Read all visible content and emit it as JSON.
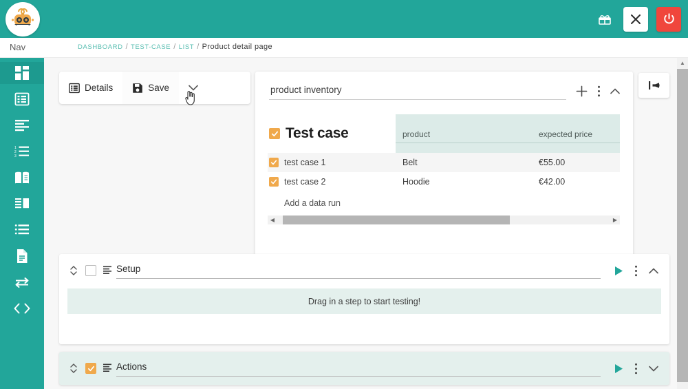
{
  "app": {
    "logo_alt": "robot-avatar-logo",
    "theme_color": "#22a69a",
    "accent_orange": "#f0a94c",
    "danger_color": "#f0463c",
    "panel_tint": "#e4f0ed",
    "table_header_tint": "#dcebe8"
  },
  "topbar": {
    "gift_icon": "gift-icon",
    "close_label": "✕",
    "power_icon": "power-icon"
  },
  "sidebar": {
    "nav_label": "Nav",
    "items": [
      {
        "name": "dashboard",
        "icon": "grid-icon",
        "active": true
      },
      {
        "name": "test-case-list",
        "icon": "list-alt-icon",
        "active": false
      },
      {
        "name": "align-left",
        "icon": "align-left-icon",
        "active": false
      },
      {
        "name": "ordered-list",
        "icon": "list-ol-icon",
        "active": false
      },
      {
        "name": "book",
        "icon": "book-icon",
        "active": false
      },
      {
        "name": "columns",
        "icon": "columns-icon",
        "active": false
      },
      {
        "name": "list",
        "icon": "list-icon",
        "active": false
      },
      {
        "name": "file",
        "icon": "file-icon",
        "active": false
      },
      {
        "name": "exchange",
        "icon": "exchange-icon",
        "active": false
      },
      {
        "name": "code",
        "icon": "code-icon",
        "active": false
      }
    ]
  },
  "breadcrumb": {
    "items": [
      "DASHBOARD",
      "TEST-CASE",
      "LIST"
    ],
    "separator": "/",
    "current": "Product detail page"
  },
  "toolbar": {
    "details_label": "Details",
    "details_icon": "list-alt-icon",
    "save_label": "Save",
    "save_icon": "floppy-disk-icon",
    "chevron_icon": "chevron-down-icon",
    "cursor": "hand-pointer-cursor"
  },
  "collapse_button": {
    "icon": "collapse-left-icon"
  },
  "inventory_panel": {
    "title_value": "product inventory",
    "title_placeholder": "product inventory",
    "add_icon": "plus-icon",
    "menu_icon": "dots-vertical-icon",
    "collapse_icon": "chevron-up-icon",
    "table": {
      "title": "Test case",
      "title_checked": true,
      "columns": [
        "product",
        "expected price"
      ],
      "rows": [
        {
          "label": "test case 1",
          "checked": true,
          "product": "Belt",
          "expected_price": "€55.00"
        },
        {
          "label": "test case 2",
          "checked": true,
          "product": "Hoodie",
          "expected_price": "€42.00"
        }
      ],
      "add_row_label": "Add a data run"
    },
    "hscroll": {
      "left_arrow": "◀",
      "right_arrow": "▶"
    }
  },
  "steps": [
    {
      "name": "Setup",
      "checked": false,
      "expanded": true,
      "lines_icon": "step-lines-icon",
      "play_icon": "play-icon",
      "menu_icon": "dots-vertical-icon",
      "chevron_icon": "chevron-up-icon",
      "drop_zone_label": "Drag in a step to start testing!"
    },
    {
      "name": "Actions",
      "checked": true,
      "expanded": false,
      "lines_icon": "step-lines-icon",
      "play_icon": "play-icon",
      "menu_icon": "dots-vertical-icon",
      "chevron_icon": "chevron-down-icon"
    }
  ],
  "scrollbars": {
    "vertical_up_arrow": "▲"
  }
}
